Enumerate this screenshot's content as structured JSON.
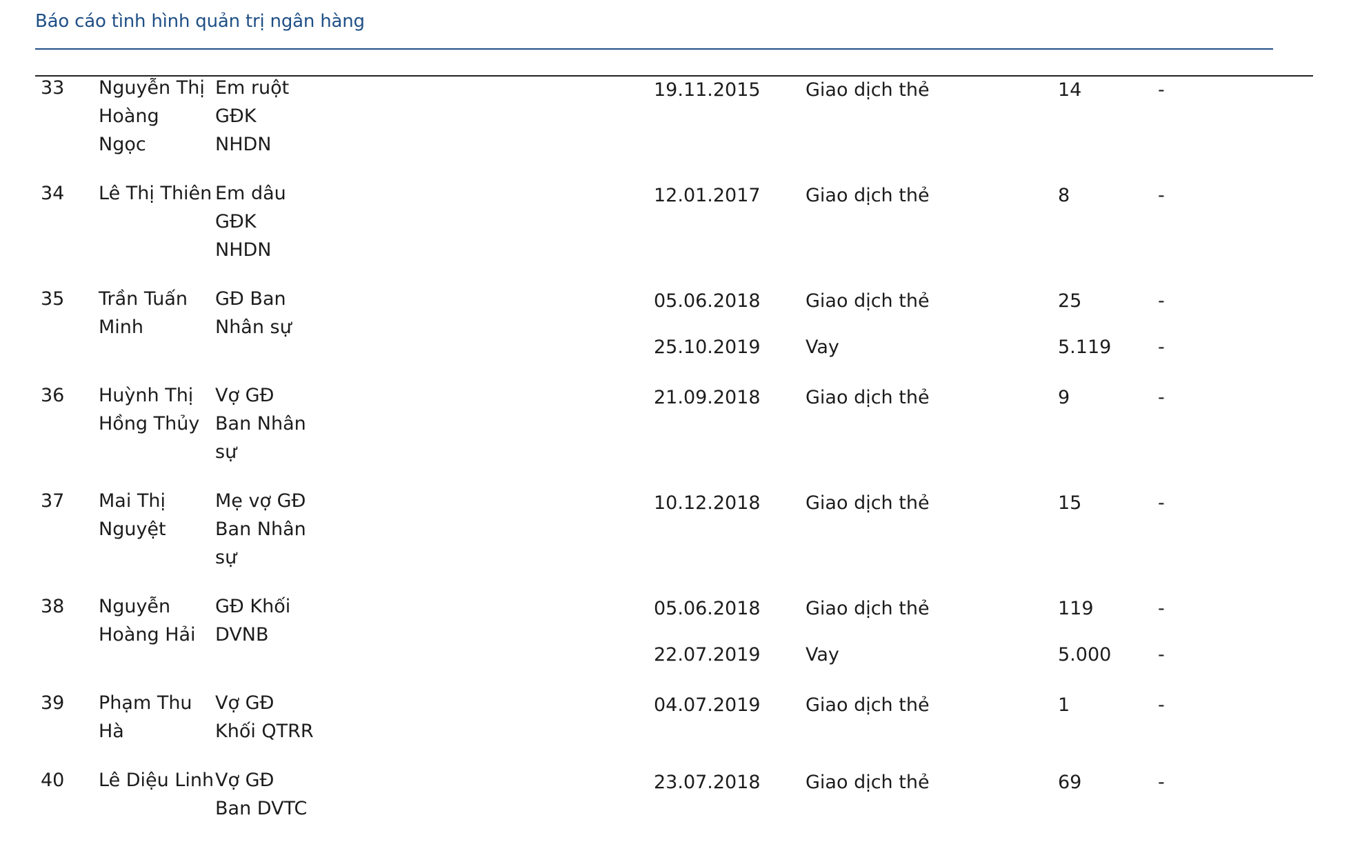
{
  "header": {
    "title": "Báo cáo tình hình quản trị ngân hàng"
  },
  "rows": [
    {
      "no": "33",
      "name_lines": [
        "Nguyễn Thị",
        "Hoàng",
        "Ngọc"
      ],
      "relation_lines": [
        "Em ruột",
        "GĐK",
        "NHDN"
      ],
      "transactions": [
        {
          "date": "19.11.2015",
          "type": "Giao dịch thẻ",
          "amount": "14",
          "extra": "-"
        }
      ]
    },
    {
      "no": "34",
      "name_lines": [
        "Lê Thị Thiên"
      ],
      "relation_lines": [
        "Em dâu",
        "GĐK",
        "NHDN"
      ],
      "transactions": [
        {
          "date": "12.01.2017",
          "type": "Giao dịch thẻ",
          "amount": "8",
          "extra": "-"
        }
      ]
    },
    {
      "no": "35",
      "name_lines": [
        "Trần Tuấn",
        "Minh"
      ],
      "relation_lines": [
        "GĐ Ban",
        "Nhân sự"
      ],
      "transactions": [
        {
          "date": "05.06.2018",
          "type": "Giao dịch thẻ",
          "amount": "25",
          "extra": "-"
        },
        {
          "date": "25.10.2019",
          "type": "Vay",
          "amount": "5.119",
          "extra": "-"
        }
      ]
    },
    {
      "no": "36",
      "name_lines": [
        "Huỳnh Thị",
        "Hồng Thủy"
      ],
      "relation_lines": [
        "Vợ GĐ",
        "Ban Nhân",
        "sự"
      ],
      "transactions": [
        {
          "date": "21.09.2018",
          "type": "Giao dịch thẻ",
          "amount": "9",
          "extra": "-"
        }
      ]
    },
    {
      "no": "37",
      "name_lines": [
        "Mai Thị",
        "Nguyệt"
      ],
      "relation_lines": [
        "Mẹ vợ GĐ",
        "Ban Nhân",
        "sự"
      ],
      "transactions": [
        {
          "date": "10.12.2018",
          "type": "Giao dịch thẻ",
          "amount": "15",
          "extra": "-"
        }
      ]
    },
    {
      "no": "38",
      "name_lines": [
        "Nguyễn",
        "Hoàng Hải"
      ],
      "relation_lines": [
        "GĐ Khối",
        "DVNB"
      ],
      "transactions": [
        {
          "date": "05.06.2018",
          "type": "Giao dịch thẻ",
          "amount": "119",
          "extra": "-"
        },
        {
          "date": "22.07.2019",
          "type": "Vay",
          "amount": "5.000",
          "extra": "-"
        }
      ]
    },
    {
      "no": "39",
      "name_lines": [
        "Phạm Thu",
        "Hà"
      ],
      "relation_lines": [
        "Vợ GĐ",
        "Khối QTRR"
      ],
      "transactions": [
        {
          "date": "04.07.2019",
          "type": "Giao dịch thẻ",
          "amount": "1",
          "extra": "-"
        }
      ]
    },
    {
      "no": "40",
      "name_lines": [
        "Lê Diệu Linh"
      ],
      "relation_lines": [
        "Vợ GĐ",
        "Ban DVTC"
      ],
      "transactions": [
        {
          "date": "23.07.2018",
          "type": "Giao dịch thẻ",
          "amount": "69",
          "extra": "-"
        }
      ]
    }
  ]
}
